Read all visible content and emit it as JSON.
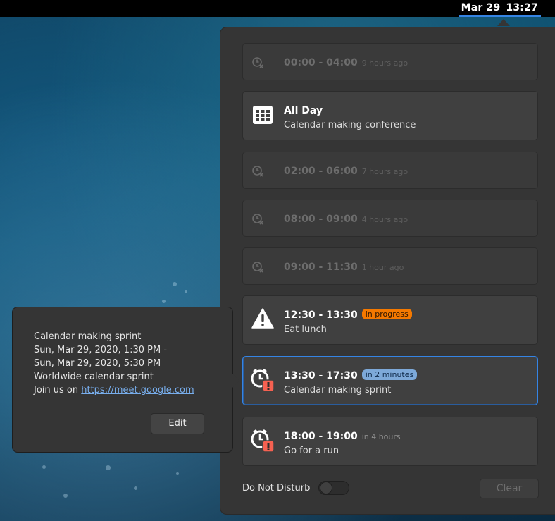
{
  "topbar": {
    "date": "Mar 29",
    "time": "13:27"
  },
  "events": [
    {
      "time": "00:00 - 04:00",
      "ago": "9 hours ago",
      "state": "past",
      "icon": "clock-past-icon"
    },
    {
      "time": "All Day",
      "title": "Calendar making conference",
      "state": "all-day",
      "icon": "calendar-grid-icon"
    },
    {
      "time": "02:00 - 06:00",
      "ago": "7 hours ago",
      "state": "past",
      "icon": "clock-past-icon"
    },
    {
      "time": "08:00 - 09:00",
      "ago": "4 hours ago",
      "state": "past",
      "icon": "clock-past-icon"
    },
    {
      "time": "09:00 - 11:30",
      "ago": "1 hour ago",
      "state": "past",
      "icon": "clock-past-icon"
    },
    {
      "time": "12:30 - 13:30",
      "badge": "in progress",
      "title": "Eat lunch",
      "state": "current",
      "icon": "warning-icon"
    },
    {
      "time": "13:30 - 17:30",
      "badge": "in 2 minutes",
      "title": "Calendar making sprint",
      "state": "upcoming",
      "icon": "alarm-clock-icon"
    },
    {
      "time": "18:00 - 19:00",
      "ago": "in 4 hours",
      "title": "Go for a run",
      "state": "upcoming",
      "icon": "alarm-clock-icon"
    }
  ],
  "footer": {
    "dnd_label": "Do Not Disturb",
    "dnd_enabled": false,
    "clear_label": "Clear"
  },
  "popover": {
    "title": "Calendar making sprint",
    "start": "Sun, Mar 29, 2020, 1:30 PM -",
    "end": "Sun, Mar 29, 2020, 5:30 PM",
    "description": "Worldwide calendar sprint",
    "join_prefix": "Join us on",
    "link": "https://meet.google.com",
    "edit_label": "Edit"
  },
  "colors": {
    "accent": "#3584e4",
    "in_progress": "#f57900",
    "soon": "#7da9d9",
    "alarm": "#f66151"
  }
}
